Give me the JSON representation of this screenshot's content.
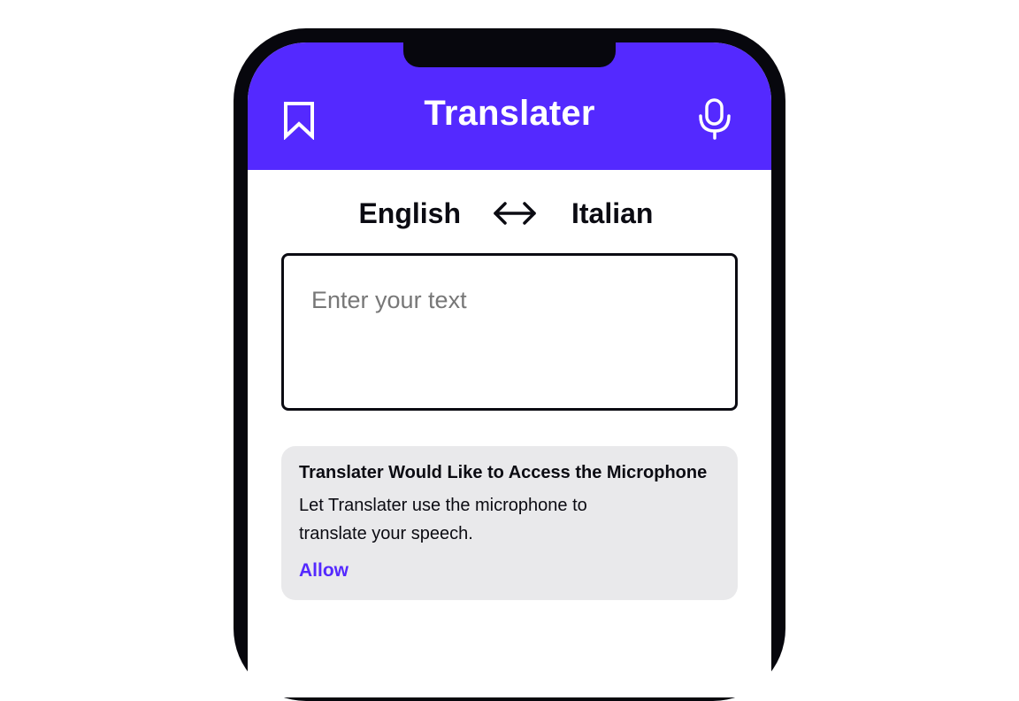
{
  "app": {
    "title": "Translater"
  },
  "header": {
    "bookmark_icon": "bookmark-icon",
    "microphone_icon": "microphone-icon"
  },
  "languages": {
    "source": "English",
    "target": "Italian",
    "swap_icon": "swap-arrows-icon"
  },
  "input": {
    "value": "",
    "placeholder": "Enter your text"
  },
  "permission": {
    "title": "Translater Would Like to Access the Microphone",
    "body": "Let Translater use the microphone to translate your speech.",
    "allow_label": "Allow"
  },
  "colors": {
    "accent": "#5429ff",
    "frame": "#07070d",
    "card_background": "#e9e9eb",
    "text": "#0b0b12",
    "placeholder": "#777777"
  }
}
